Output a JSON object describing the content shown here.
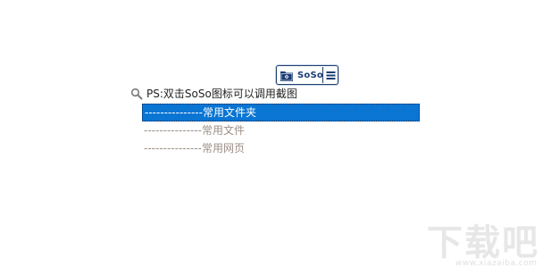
{
  "toolbar": {
    "logo_label": "SoSo",
    "logo_icon": "soso-folder-icon",
    "menu_icon": "hamburger-menu-icon"
  },
  "hint": {
    "icon": "search-icon",
    "text": "PS:双击SoSo图标可以调用截图"
  },
  "list": {
    "items": [
      {
        "label": "---------------常用文件夹",
        "selected": true
      },
      {
        "label": "---------------常用文件",
        "selected": false
      },
      {
        "label": "---------------常用网页",
        "selected": false
      }
    ]
  },
  "watermark": {
    "main": "下载吧",
    "sub": "www.xiazaiba.com"
  },
  "colors": {
    "selection": "#0a75d3",
    "toolbar_border": "#1f3f6e",
    "muted_text": "#9b8f86"
  }
}
